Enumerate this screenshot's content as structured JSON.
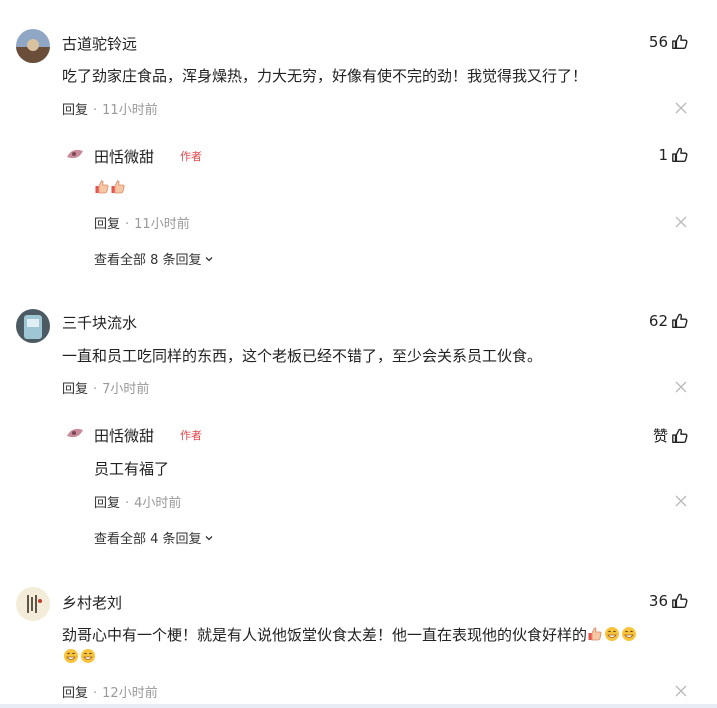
{
  "comments": [
    {
      "user": "古道驼铃远",
      "likes": "56",
      "text": "吃了劲家庄食品，浑身燥热，力大无穷，好像有使不完的劲！我觉得我又行了！",
      "reply_label": "回复",
      "time": "11小时前",
      "sub": {
        "user": "田恬微甜",
        "tag": "作者",
        "likes": "1",
        "text": "",
        "emojis": [
          "thumbs-up",
          "thumbs-up"
        ],
        "reply_label": "回复",
        "time": "11小时前",
        "more": "查看全部 8 条回复"
      }
    },
    {
      "user": "三千块流水",
      "likes": "62",
      "text": "一直和员工吃同样的东西，这个老板已经不错了，至少会关系员工伙食。",
      "reply_label": "回复",
      "time": "7小时前",
      "sub": {
        "user": "田恬微甜",
        "tag": "作者",
        "likes": "赞",
        "text": "员工有福了",
        "reply_label": "回复",
        "time": "4小时前",
        "more": "查看全部 4 条回复"
      }
    },
    {
      "user": "乡村老刘",
      "likes": "36",
      "text": "劲哥心中有一个梗！就是有人说他饭堂伙食太差！他一直在表现他的伙食好样的",
      "reply_label": "回复",
      "time": "12小时前"
    }
  ],
  "colors": {
    "author_tag": "#e0484e",
    "muted": "#999999",
    "text": "#222222"
  },
  "icons": {
    "like": "thumbs-up-icon",
    "close": "close-icon",
    "expand": "chevron-down-icon"
  }
}
